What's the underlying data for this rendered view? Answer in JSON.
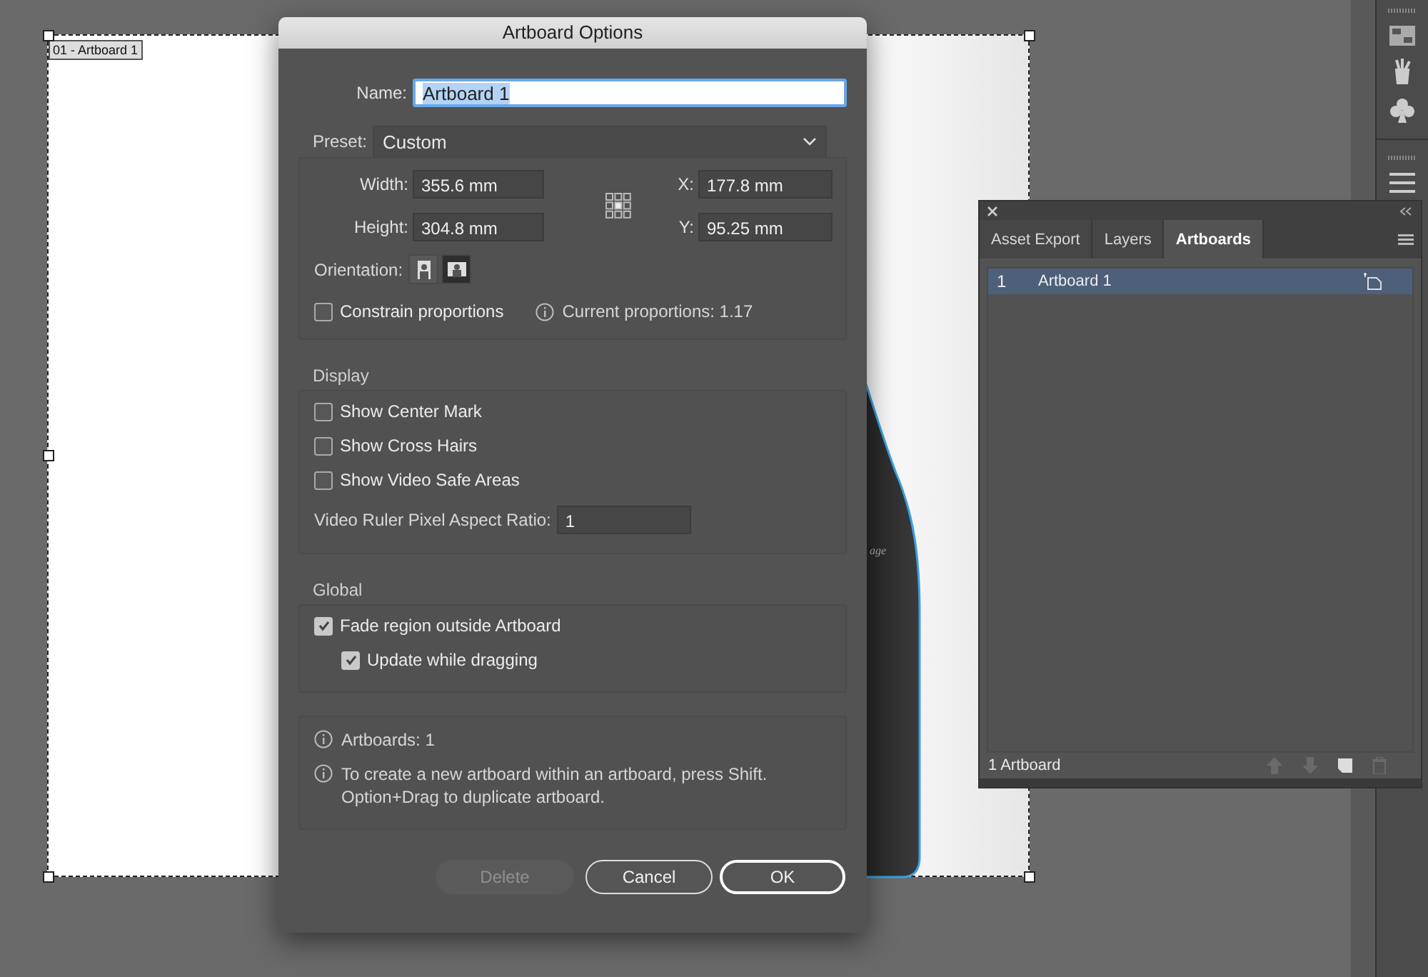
{
  "canvas": {
    "artboard_label": "01 - Artboard 1",
    "bottle_text": "age"
  },
  "dialog": {
    "title": "Artboard Options",
    "name_label": "Name:",
    "name_value": "Artboard 1",
    "preset_label": "Preset:",
    "preset_value": "Custom",
    "width_label": "Width:",
    "width_value": "355.6 mm",
    "height_label": "Height:",
    "height_value": "304.8 mm",
    "x_label": "X:",
    "x_value": "177.8 mm",
    "y_label": "Y:",
    "y_value": "95.25 mm",
    "orientation_label": "Orientation:",
    "orientation": [
      {
        "kind": "portrait",
        "selected": false
      },
      {
        "kind": "landscape",
        "selected": true
      }
    ],
    "constrain": {
      "label": "Constrain proportions",
      "checked": false
    },
    "proportions": "Current proportions: 1.17",
    "display": {
      "heading": "Display",
      "options": [
        {
          "label": "Show Center Mark",
          "checked": false
        },
        {
          "label": "Show Cross Hairs",
          "checked": false
        },
        {
          "label": "Show Video Safe Areas",
          "checked": false
        }
      ],
      "ratio_label": "Video Ruler Pixel Aspect Ratio:",
      "ratio_value": "1"
    },
    "global": {
      "heading": "Global",
      "options": [
        {
          "label": "Fade region outside Artboard",
          "checked": true,
          "children": [
            {
              "label": "Update while dragging",
              "checked": true
            }
          ]
        }
      ]
    },
    "info": [
      "Artboards: 1",
      "To create a new artboard within an artboard, press Shift. Option+Drag to duplicate artboard."
    ],
    "buttons": [
      {
        "label": "Delete",
        "disabled": true,
        "default": false
      },
      {
        "label": "Cancel",
        "disabled": false,
        "default": false
      },
      {
        "label": "OK",
        "disabled": false,
        "default": true
      }
    ]
  },
  "panel": {
    "tabs": [
      {
        "label": "Asset Export",
        "selected": false
      },
      {
        "label": "Layers",
        "selected": false
      },
      {
        "label": "Artboards",
        "selected": true
      }
    ],
    "rows": [
      {
        "number": "1",
        "name": "Artboard 1",
        "selected": true
      }
    ],
    "footer": "1 Artboard"
  }
}
